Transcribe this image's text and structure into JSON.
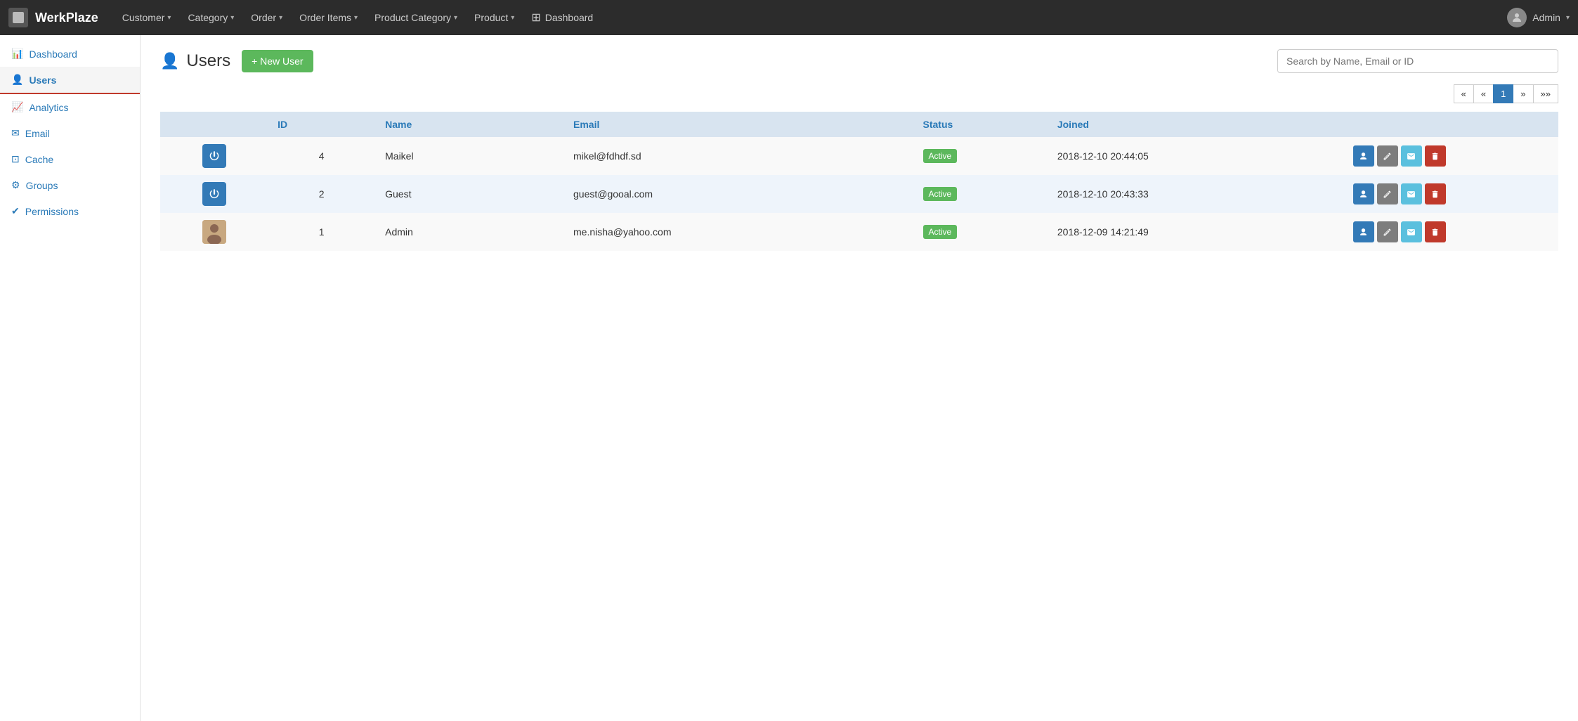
{
  "topnav": {
    "brand": "WerkPlaze",
    "items": [
      {
        "label": "Customer",
        "id": "customer"
      },
      {
        "label": "Category",
        "id": "category"
      },
      {
        "label": "Order",
        "id": "order"
      },
      {
        "label": "Order Items",
        "id": "order-items"
      },
      {
        "label": "Product Category",
        "id": "product-category"
      },
      {
        "label": "Product",
        "id": "product"
      },
      {
        "label": "Dashboard",
        "id": "dashboard",
        "icon": "dashboard-icon"
      }
    ],
    "admin_label": "Admin"
  },
  "sidebar": {
    "items": [
      {
        "label": "Dashboard",
        "id": "dashboard",
        "icon": "chart-icon"
      },
      {
        "label": "Users",
        "id": "users",
        "icon": "users-icon",
        "active": true
      },
      {
        "label": "Analytics",
        "id": "analytics",
        "icon": "analytics-icon"
      },
      {
        "label": "Email",
        "id": "email",
        "icon": "email-icon"
      },
      {
        "label": "Cache",
        "id": "cache",
        "icon": "cache-icon"
      },
      {
        "label": "Groups",
        "id": "groups",
        "icon": "groups-icon"
      },
      {
        "label": "Permissions",
        "id": "permissions",
        "icon": "permissions-icon"
      }
    ]
  },
  "page": {
    "title": "Users",
    "new_user_btn": "+ New User",
    "search_placeholder": "Search by Name, Email or ID"
  },
  "pagination": {
    "first": "«",
    "prev": "‹",
    "current": "1",
    "next": "›",
    "last": "»"
  },
  "table": {
    "columns": [
      "ID",
      "Name",
      "Email",
      "Status",
      "Joined"
    ],
    "rows": [
      {
        "id": "4",
        "name": "Maikel",
        "email": "mikel@fdhdf.sd",
        "status": "Active",
        "joined": "2018-12-10 20:44:05",
        "avatar_type": "icon"
      },
      {
        "id": "2",
        "name": "Guest",
        "email": "guest@gooal.com",
        "status": "Active",
        "joined": "2018-12-10 20:43:33",
        "avatar_type": "icon"
      },
      {
        "id": "1",
        "name": "Admin",
        "email": "me.nisha@yahoo.com",
        "status": "Active",
        "joined": "2018-12-09 14:21:49",
        "avatar_type": "img"
      }
    ]
  },
  "actions": {
    "view": "👤",
    "edit": "✏",
    "email": "✉",
    "delete": "🗑"
  }
}
